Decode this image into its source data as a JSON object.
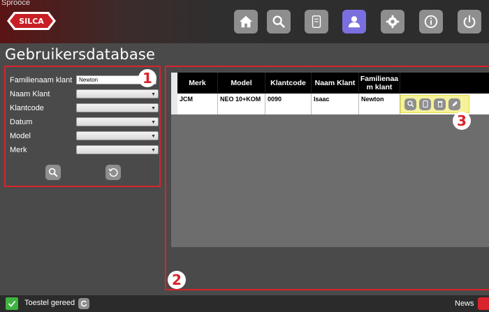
{
  "window": {
    "title_fragment": "Sprooce"
  },
  "brand": {
    "logo_text": "SILCA"
  },
  "nav": {
    "buttons": [
      {
        "name": "home",
        "icon": "home-icon",
        "active": false
      },
      {
        "name": "search",
        "icon": "search-icon",
        "active": false
      },
      {
        "name": "database",
        "icon": "database-icon",
        "active": false
      },
      {
        "name": "users",
        "icon": "user-icon",
        "active": true
      },
      {
        "name": "settings",
        "icon": "gear-icon",
        "active": false
      },
      {
        "name": "info",
        "icon": "info-icon",
        "active": false
      },
      {
        "name": "power",
        "icon": "power-icon",
        "active": false
      }
    ]
  },
  "page": {
    "title": "Gebruikersdatabase"
  },
  "filters": {
    "familienaam": {
      "label": "Familienaam klant",
      "value": "Newton"
    },
    "naam": {
      "label": "Naam Klant",
      "value": ""
    },
    "klantcode": {
      "label": "Klantcode",
      "value": ""
    },
    "datum": {
      "label": "Datum",
      "value": ""
    },
    "model": {
      "label": "Model",
      "value": ""
    },
    "merk": {
      "label": "Merk",
      "value": ""
    }
  },
  "markers": {
    "one": "1",
    "two": "2",
    "three": "3"
  },
  "table": {
    "headers": [
      "Merk",
      "Model",
      "Klantcode",
      "Naam Klant",
      "Familienaa m klant"
    ],
    "rows": [
      {
        "merk": "JCM",
        "model": "NEO 10+KOM",
        "klantcode": "0090",
        "naam": "Isaac",
        "familienaam": "Newton"
      }
    ]
  },
  "status": {
    "text": "Toestel gereed",
    "news": "News"
  },
  "colors": {
    "accent_red": "#d9232b",
    "active_nav": "#7b6fe0",
    "button_grey": "#8e8e8e",
    "highlight_yellow": "#f5f29a"
  }
}
